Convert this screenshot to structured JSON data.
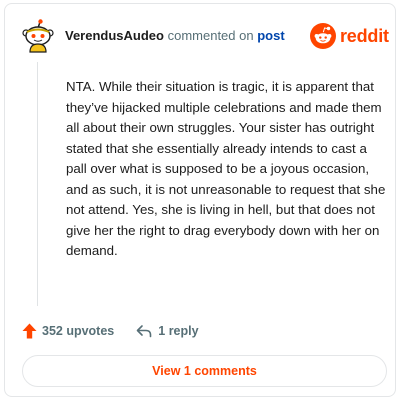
{
  "colors": {
    "accent": "#ff4500",
    "link": "#0045ac",
    "text": "#1c1c1c",
    "muted": "#576f76",
    "border": "#e4e6e8"
  },
  "header": {
    "avatar_icon": "snoo-avatar-icon",
    "username": "VerendusAudeo",
    "action_text": "commented on",
    "post_link": "post"
  },
  "brand": {
    "logo_icon": "reddit-snoo-icon",
    "wordmark": "reddit"
  },
  "comment": {
    "body": "NTA. While their situation is tragic, it is apparent that they’ve hijacked multiple celebrations and made them all about their own struggles. Your sister has outright stated that she essentially already intends to cast a pall over what is supposed to be a joyous occasion, and as such, it is not unreasonable to request that she not attend. Yes, she is living in hell, but that does not give her the right to drag everybody down with her on demand."
  },
  "actions": {
    "upvote_icon": "upvote-arrow-icon",
    "upvotes": "352 upvotes",
    "reply_icon": "reply-arrow-icon",
    "replies": "1 reply"
  },
  "footer": {
    "view_comments": "View 1 comments"
  }
}
